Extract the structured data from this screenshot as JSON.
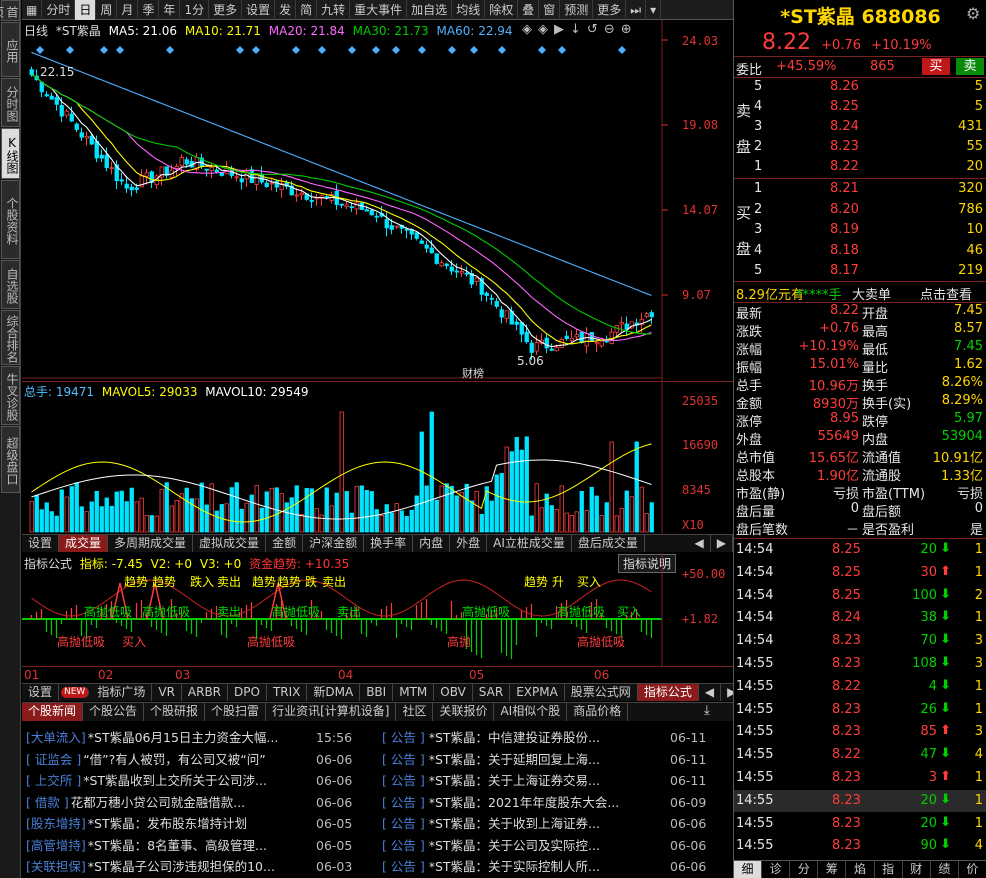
{
  "left_tabs": [
    "首页",
    "应用",
    "分时图",
    "K线图",
    "个股资料",
    "自选股",
    "综合排名",
    "牛叉诊股",
    "超级盘口"
  ],
  "toolbar": [
    "分时",
    "日",
    "周",
    "月",
    "季",
    "年",
    "1分",
    "更多",
    "设置",
    "发",
    "简",
    "九转",
    "重大事件",
    "加自选",
    "均线",
    "除权",
    "叠",
    "窗",
    "预测",
    "更多"
  ],
  "kline_legend": {
    "period": "日线",
    "name": "*ST紫晶",
    "ma5": "MA5: 21.06",
    "ma10": "MA10: 21.71",
    "ma20": "MA20: 21.84",
    "ma30": "MA30: 21.73",
    "ma60": "MA60: 22.94"
  },
  "price_axis": [
    "24.03",
    "19.08",
    "14.07",
    "9.07"
  ],
  "kline_marks": {
    "high": "22.15",
    "low": "5.06",
    "tag": "财榜"
  },
  "volume_legend": {
    "total": "总手: 19471",
    "mavol5": "MAVOL5: 29033",
    "mavol10": "MAVOL10: 29549"
  },
  "volume_axis": [
    "25035",
    "16690",
    "8345",
    "X10"
  ],
  "volume_tabs": [
    "设置",
    "成交量",
    "多周期成交量",
    "虚拟成交量",
    "金额",
    "沪深金额",
    "换手率",
    "内盘",
    "外盘",
    "AI立桩成交量",
    "盘后成交量"
  ],
  "indicator_legend": {
    "name": "指标公式",
    "l1": "指标: -7.45",
    "l2": "V2: +0",
    "l3": "V3: +0",
    "l4": "资金趋势: +10.35",
    "btn": "指标说明"
  },
  "indicator_axis": [
    "+50.00",
    "+1.82"
  ],
  "indicator_texts": [
    "趋势",
    "趋势",
    "跌入",
    "卖出",
    "趋势",
    "趋势",
    "跌",
    "卖出",
    "趋势",
    "升",
    "买入",
    "高抛低吸",
    "高抛低吸",
    "卖出",
    "高抛低吸",
    "卖出",
    "高抛低吸",
    "高抛低吸",
    "买入",
    "高抛低吸",
    "买入",
    "高抛低吸",
    "高抛",
    "高抛低吸"
  ],
  "month_axis": [
    "01",
    "02",
    "03",
    "04",
    "05",
    "06"
  ],
  "indicator_tabs": [
    "设置",
    "NEW",
    "指标广场",
    "VR",
    "ARBR",
    "DPO",
    "TRIX",
    "新DMA",
    "BBI",
    "MTM",
    "OBV",
    "SAR",
    "EXPMA",
    "股票公式网",
    "指标公式"
  ],
  "news_tabs": [
    "个股新闻",
    "个股公告",
    "个股研报",
    "个股扫雷",
    "行业资讯[计算机设备]",
    "社区",
    "关联报价",
    "AI相似个股",
    "商品价格"
  ],
  "news_left": [
    {
      "tag": "[大单流入]",
      "title": "*ST紫晶06月15日主力资金大幅...",
      "date": "15:56"
    },
    {
      "tag": "[ 证监会 ]",
      "title": "“借”?有人被罚，有公司又被“问”",
      "date": "06-06"
    },
    {
      "tag": "[ 上交所 ]",
      "title": "*ST紫晶收到上交所关于公司涉...",
      "date": "06-06"
    },
    {
      "tag": "[ 借款 ]",
      "title": "花都万穗小贷公司就金融借款...",
      "date": "06-06"
    },
    {
      "tag": "[股东增持]",
      "title": "*ST紫晶：发布股东增持计划",
      "date": "06-05"
    },
    {
      "tag": "[高管增持]",
      "title": "*ST紫晶：8名董事、高级管理...",
      "date": "06-05"
    },
    {
      "tag": "[关联担保]",
      "title": "*ST紫晶子公司涉违规担保的10...",
      "date": "06-03"
    }
  ],
  "news_right": [
    {
      "tag": "[ 公告 ]",
      "title": "*ST紫晶：中信建投证券股份...",
      "date": "06-11"
    },
    {
      "tag": "[ 公告 ]",
      "title": "*ST紫晶：关于延期回复上海...",
      "date": "06-11"
    },
    {
      "tag": "[ 公告 ]",
      "title": "*ST紫晶：关于上海证券交易...",
      "date": "06-11"
    },
    {
      "tag": "[ 公告 ]",
      "title": "*ST紫晶：2021年年度股东大会...",
      "date": "06-09"
    },
    {
      "tag": "[ 公告 ]",
      "title": "*ST紫晶：关于收到上海证券...",
      "date": "06-06"
    },
    {
      "tag": "[ 公告 ]",
      "title": "*ST紫晶：关于公司及实际控...",
      "date": "06-06"
    },
    {
      "tag": "[ 公告 ]",
      "title": "*ST紫晶：关于实际控制人所...",
      "date": "06-06"
    }
  ],
  "quote": {
    "name": "*ST紫晶",
    "code": "688086",
    "price": "8.22",
    "change": "+0.76",
    "pct": "+10.19%",
    "weibi_label": "委比",
    "weibi": "+45.59%",
    "weicha": "865",
    "buy_btn": "买",
    "sell_btn": "卖",
    "sell_label": [
      "卖",
      "盘"
    ],
    "buy_label": [
      "买",
      "盘"
    ],
    "asks": [
      {
        "lvl": "5",
        "price": "8.26",
        "vol": "5"
      },
      {
        "lvl": "4",
        "price": "8.25",
        "vol": "5"
      },
      {
        "lvl": "3",
        "price": "8.24",
        "vol": "431"
      },
      {
        "lvl": "2",
        "price": "8.23",
        "vol": "55"
      },
      {
        "lvl": "1",
        "price": "8.22",
        "vol": "20"
      }
    ],
    "bids": [
      {
        "lvl": "1",
        "price": "8.21",
        "vol": "320"
      },
      {
        "lvl": "2",
        "price": "8.20",
        "vol": "786"
      },
      {
        "lvl": "3",
        "price": "8.19",
        "vol": "10"
      },
      {
        "lvl": "4",
        "price": "8.18",
        "vol": "46"
      },
      {
        "lvl": "5",
        "price": "8.17",
        "vol": "219"
      }
    ],
    "bigorder": {
      "a": "8.29亿元有",
      "b": "*****手",
      "c": "大卖单",
      "d": "点击查看"
    },
    "stats": [
      [
        "最新",
        "8.22",
        "开盘",
        "7.45"
      ],
      [
        "涨跌",
        "+0.76",
        "最高",
        "8.57"
      ],
      [
        "涨幅",
        "+10.19%",
        "最低",
        "7.45"
      ],
      [
        "振幅",
        "15.01%",
        "量比",
        "1.62"
      ],
      [
        "总手",
        "10.96万",
        "换手",
        "8.26%"
      ],
      [
        "金额",
        "8930万",
        "换手(实)",
        "8.29%"
      ],
      [
        "涨停",
        "8.95",
        "跌停",
        "5.97"
      ],
      [
        "外盘",
        "55649",
        "内盘",
        "53904"
      ],
      [
        "总市值",
        "15.65亿",
        "流通值",
        "10.91亿"
      ],
      [
        "总股本",
        "1.90亿",
        "流通股",
        "1.33亿"
      ],
      [
        "市盈(静)",
        "亏损",
        "市盈(TTM)",
        "亏损"
      ],
      [
        "盘后量",
        "0",
        "盘后额",
        "0"
      ],
      [
        "盘后笔数",
        "－",
        "是否盈利",
        "是"
      ]
    ],
    "ticks": [
      {
        "t": "14:54",
        "p": "8.25",
        "v": "20",
        "d": "down",
        "n": "1"
      },
      {
        "t": "14:54",
        "p": "8.25",
        "v": "30",
        "d": "up",
        "n": "1"
      },
      {
        "t": "14:54",
        "p": "8.25",
        "v": "100",
        "d": "down",
        "n": "2"
      },
      {
        "t": "14:54",
        "p": "8.24",
        "v": "38",
        "d": "down",
        "n": "1"
      },
      {
        "t": "14:54",
        "p": "8.23",
        "v": "70",
        "d": "down",
        "n": "3"
      },
      {
        "t": "14:55",
        "p": "8.23",
        "v": "108",
        "d": "down",
        "n": "3"
      },
      {
        "t": "14:55",
        "p": "8.22",
        "v": "4",
        "d": "down",
        "n": "1"
      },
      {
        "t": "14:55",
        "p": "8.23",
        "v": "26",
        "d": "down",
        "n": "1"
      },
      {
        "t": "14:55",
        "p": "8.23",
        "v": "85",
        "d": "up",
        "n": "3"
      },
      {
        "t": "14:55",
        "p": "8.22",
        "v": "47",
        "d": "down",
        "n": "4"
      },
      {
        "t": "14:55",
        "p": "8.23",
        "v": "3",
        "d": "up",
        "n": "1"
      },
      {
        "t": "14:55",
        "p": "8.23",
        "v": "20",
        "d": "down",
        "n": "1"
      },
      {
        "t": "14:55",
        "p": "8.23",
        "v": "20",
        "d": "down",
        "n": "1"
      },
      {
        "t": "14:55",
        "p": "8.23",
        "v": "90",
        "d": "down",
        "n": "4"
      }
    ],
    "bottom_tabs": [
      "细",
      "诊",
      "分",
      "筹",
      "焰",
      "指",
      "财",
      "绩",
      "价"
    ]
  },
  "colors": {
    "up": "#ff3c3c",
    "down": "#00d000",
    "ma5": "#ffffff",
    "ma10": "#ffff00",
    "ma20": "#ff66ff",
    "ma30": "#00cc00",
    "ma60": "#4fb0ff"
  }
}
